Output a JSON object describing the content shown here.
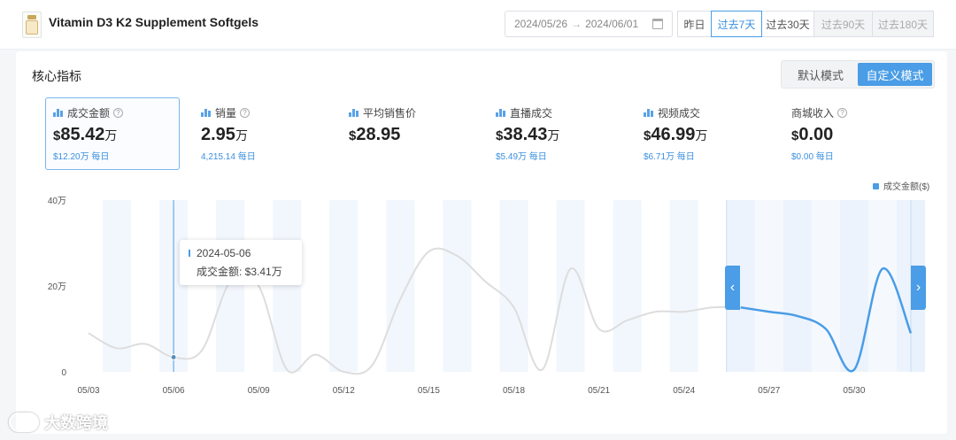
{
  "header": {
    "product_title": "Vitamin D3 K2 Supplement Softgels",
    "date_start": "2024/05/26",
    "date_end": "2024/06/01",
    "range_buttons": [
      "昨日",
      "过去7天",
      "过去30天",
      "过去90天",
      "过去180天"
    ],
    "active_range": "过去7天"
  },
  "panel": {
    "section_title": "核心指标",
    "modes": [
      "默认模式",
      "自定义模式"
    ],
    "active_mode": "自定义模式"
  },
  "metrics": [
    {
      "label": "成交金额",
      "currency": "$",
      "value": "85.42",
      "unit": "万",
      "sub": "$12.20万 每日",
      "help": true,
      "active": true
    },
    {
      "label": "销量",
      "currency": "",
      "value": "2.95",
      "unit": "万",
      "sub": "4,215.14 每日",
      "help": true,
      "active": false
    },
    {
      "label": "平均销售价",
      "currency": "$",
      "value": "28.95",
      "unit": "",
      "sub": "",
      "help": false,
      "active": false
    },
    {
      "label": "直播成交",
      "currency": "$",
      "value": "38.43",
      "unit": "万",
      "sub": "$5.49万 每日",
      "help": false,
      "active": false
    },
    {
      "label": "视频成交",
      "currency": "$",
      "value": "46.99",
      "unit": "万",
      "sub": "$6.71万 每日",
      "help": false,
      "active": false
    },
    {
      "label": "商城收入",
      "currency": "$",
      "value": "0.00",
      "unit": "",
      "sub": "$0.00 每日",
      "help": true,
      "active": false
    }
  ],
  "tooltip": {
    "date": "2024-05-06",
    "label": "成交金额: $3.41万"
  },
  "watermark": "大数跨境",
  "colors": {
    "accent": "#4a9de6",
    "line_inactive": "#dddddd",
    "band": "#f2f7fd"
  },
  "chart_data": {
    "type": "line",
    "legend": "成交金额($)",
    "legend_position": "top-right",
    "y_tick_labels": [
      "0",
      "20万",
      "40万"
    ],
    "y_ticks": [
      0,
      20,
      40
    ],
    "ylim": [
      0,
      40
    ],
    "x_tick_labels": [
      "05/03",
      "05/06",
      "05/09",
      "05/12",
      "05/15",
      "05/18",
      "05/21",
      "05/24",
      "05/27",
      "05/30"
    ],
    "x_tick_days": [
      3,
      6,
      9,
      12,
      15,
      18,
      21,
      24,
      27,
      30
    ],
    "x_range_days": [
      3,
      32
    ],
    "selected_range_days": [
      26,
      32
    ],
    "tooltip_day": 6,
    "series": [
      {
        "name": "成交金额($)",
        "x": [
          3,
          4,
          5,
          6,
          7,
          8,
          9,
          10,
          11,
          12,
          13,
          14,
          15,
          16,
          17,
          18,
          19,
          20,
          21,
          22,
          23,
          24,
          25,
          26,
          27,
          28,
          29,
          30,
          31,
          32
        ],
        "values": [
          9,
          5.5,
          6.5,
          3.41,
          5,
          21,
          20,
          0.5,
          4,
          0,
          1.5,
          17,
          28,
          27,
          21,
          15,
          0.5,
          24,
          10,
          12,
          14,
          14,
          15,
          15,
          14,
          13,
          10,
          0.5,
          24,
          9
        ]
      }
    ]
  }
}
